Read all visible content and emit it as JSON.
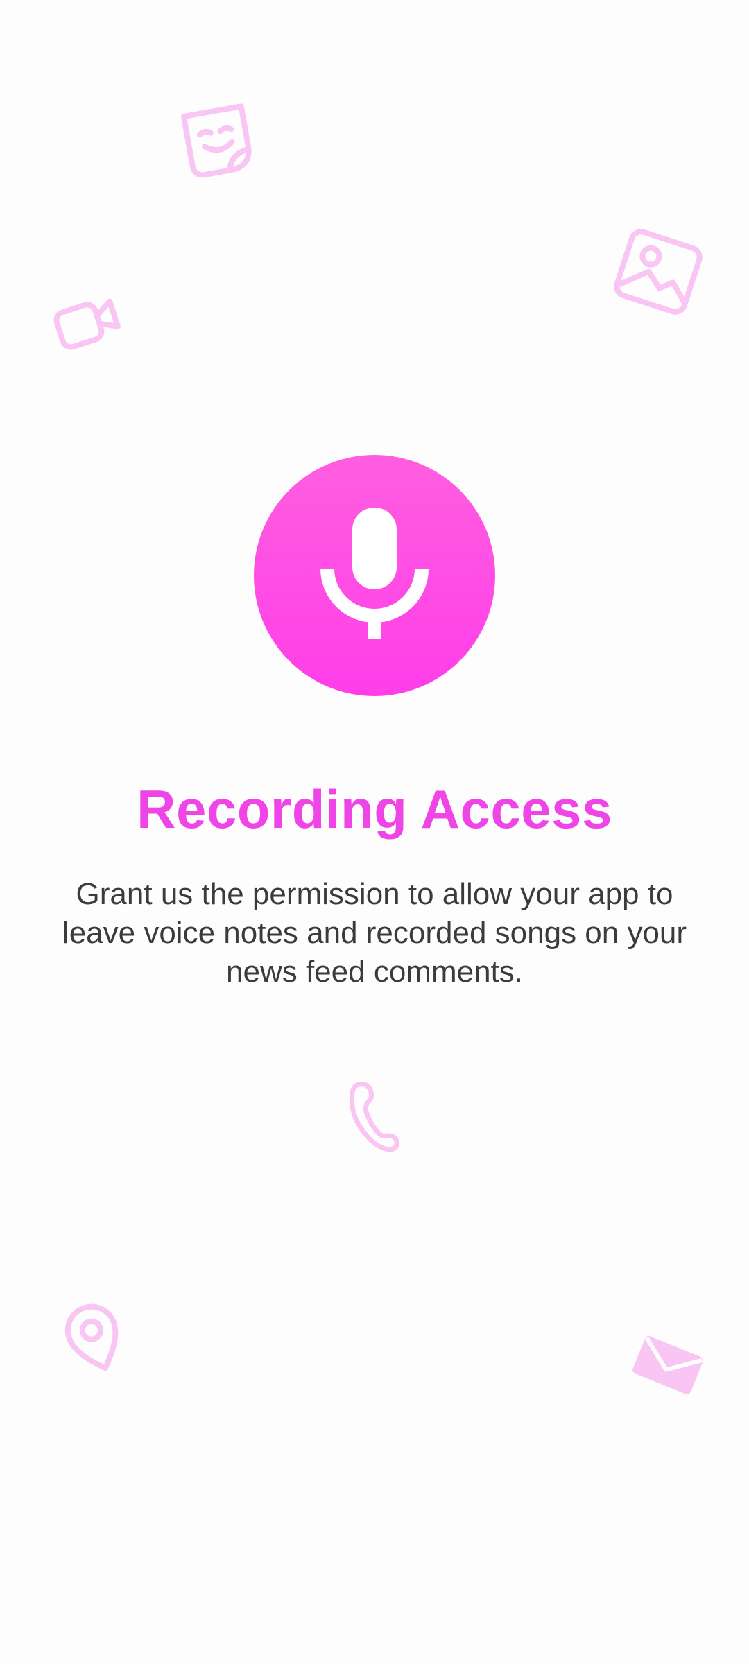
{
  "permission": {
    "title": "Recording Access",
    "description": "Grant us the permission to allow your app to leave voice notes and recorded songs on your news feed comments."
  },
  "theme": {
    "accent": "#ef45e6",
    "accent_light": "#f9c6f3",
    "text": "#3b3b3b",
    "background": "#fdfdfd"
  },
  "icons": {
    "main": "microphone-icon",
    "decorative": [
      "sticker-icon",
      "image-icon",
      "video-camera-icon",
      "phone-icon",
      "location-pin-icon",
      "envelope-icon"
    ]
  }
}
